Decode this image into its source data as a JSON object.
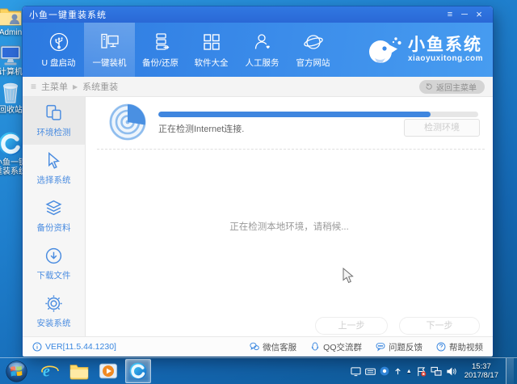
{
  "desktop": {
    "icons": [
      {
        "label": "Admin"
      },
      {
        "label": "计算机"
      },
      {
        "label": "回收站"
      },
      {
        "label": "小鱼一键重装系统"
      }
    ]
  },
  "window": {
    "title": "小鱼一键重装系统",
    "controls": {
      "menu": "≡",
      "minimize": "─",
      "close": "×"
    },
    "nav": {
      "items": [
        {
          "label": "U 盘启动"
        },
        {
          "label": "一键装机"
        },
        {
          "label": "备份/还原"
        },
        {
          "label": "软件大全"
        },
        {
          "label": "人工服务"
        },
        {
          "label": "官方网站"
        }
      ],
      "brand": {
        "name": "小鱼系统",
        "domain": "xiaoyuxitong.com"
      }
    },
    "breadcrumb": {
      "root": "主菜单",
      "arrow": "▶",
      "current": "系统重装",
      "back": "返回主菜单",
      "list_icon": "≡"
    },
    "sidebar": {
      "items": [
        {
          "label": "环境检测"
        },
        {
          "label": "选择系统"
        },
        {
          "label": "备份资料"
        },
        {
          "label": "下载文件"
        },
        {
          "label": "安装系统"
        }
      ]
    },
    "content": {
      "detect_status": "正在检测Internet连接.",
      "detect_button": "检测环境",
      "progress_percent": 85,
      "center_message": "正在检测本地环境，请稍候...",
      "prev_button": "上一步",
      "next_button": "下一步"
    },
    "statusbar": {
      "version": "VER[11.5.44.1230]",
      "links": [
        {
          "label": "微信客服"
        },
        {
          "label": "QQ交流群"
        },
        {
          "label": "问题反馈"
        },
        {
          "label": "帮助视频"
        }
      ]
    },
    "colors": {
      "accent": "#3a87e0",
      "nav_blue": "#2c79e0",
      "progress_fill": "#3f86df",
      "titlebar": "#2d6fdb"
    }
  },
  "taskbar": {
    "clock": {
      "time": "15:37",
      "date": "2017/8/17"
    },
    "hidden_icons_caret": "▲"
  }
}
